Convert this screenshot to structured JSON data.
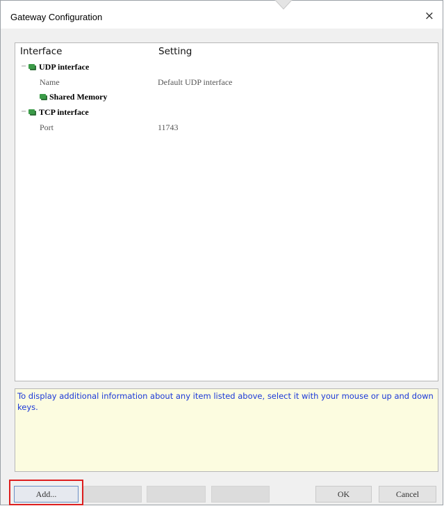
{
  "window": {
    "title": "Gateway Configuration",
    "close_glyph": "×"
  },
  "tree": {
    "columns": [
      "Interface",
      "Setting"
    ],
    "items": [
      {
        "label": "UDP interface",
        "expander": "−",
        "icon": "network-adapter-icon"
      },
      {
        "property": "Name",
        "value": "Default UDP interface"
      },
      {
        "label": "Shared Memory",
        "icon": "network-adapter-icon"
      },
      {
        "label": "TCP interface",
        "expander": "−",
        "icon": "network-adapter-icon"
      },
      {
        "property": "Port",
        "value": "11743"
      }
    ]
  },
  "info": {
    "text": "To display additional information about any item listed above, select it with your mouse or up and down keys."
  },
  "buttons": {
    "add": "Add...",
    "ok": "OK",
    "cancel": "Cancel"
  },
  "colors": {
    "info_text": "#1b38d8",
    "info_background": "#fcfce0",
    "highlight": "#dd1e1e",
    "node_icon": "#3b9b48"
  }
}
